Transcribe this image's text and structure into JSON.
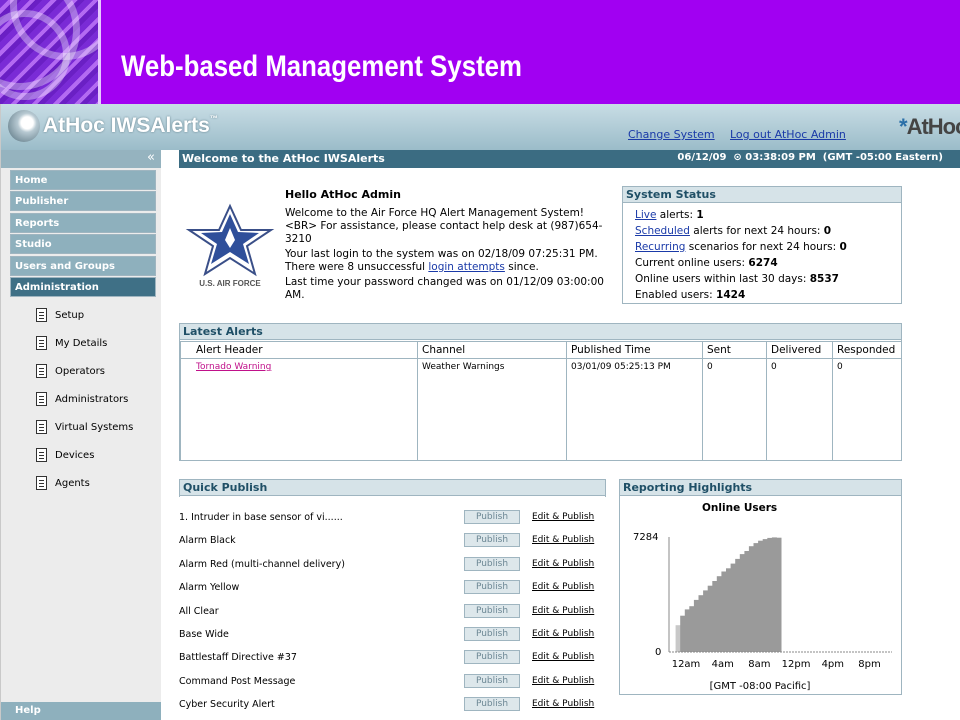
{
  "slide": {
    "title": "Web-based Management System"
  },
  "app": {
    "product_name": "AtHoc IWSAlerts",
    "trademark": "™",
    "change_system": "Change System",
    "logout": "Log out AtHoc Admin",
    "brand": "AtHoc"
  },
  "nav": {
    "collapse": "«",
    "items": [
      {
        "label": "Home"
      },
      {
        "label": "Publisher"
      },
      {
        "label": "Reports"
      },
      {
        "label": "Studio"
      },
      {
        "label": "Users and Groups"
      },
      {
        "label": "Administration"
      }
    ],
    "sub_items": [
      {
        "label": "Setup"
      },
      {
        "label": "My Details"
      },
      {
        "label": "Operators"
      },
      {
        "label": "Administrators"
      },
      {
        "label": "Virtual Systems"
      },
      {
        "label": "Devices"
      },
      {
        "label": "Agents"
      }
    ],
    "help": "Help"
  },
  "welcome": {
    "title": "Welcome to the AtHoc IWSAlerts",
    "date": "06/12/09",
    "time": "03:38:09 PM",
    "timezone": "(GMT -05:00 Eastern)"
  },
  "intro": {
    "logo_text": "U.S. AIR FORCE",
    "hello": "Hello AtHoc Admin",
    "line1": "Welcome to the Air Force HQ Alert Management System! <BR> For assistance, please contact help desk at (987)654-3210",
    "line2_pre": "Your last login to the system was on 02/18/09 07:25:31 PM. There were 8 unsuccessful",
    "line2_link": "login attempts",
    "line2_post": "since.",
    "line3": "Last time your password changed was on 01/12/09 03:00:00 AM."
  },
  "system_status": {
    "title": "System Status",
    "live_link": "Live",
    "live_text": "alerts:",
    "live_value": "1",
    "scheduled_link": "Scheduled",
    "scheduled_text": "alerts for next 24 hours:",
    "scheduled_value": "0",
    "recurring_link": "Recurring",
    "recurring_text": "scenarios for next 24 hours:",
    "recurring_value": "0",
    "online_text": "Current online users:",
    "online_value": "6274",
    "online30_text": "Online users within last 30 days:",
    "online30_value": "8537",
    "enabled_text": "Enabled users:",
    "enabled_value": "1424"
  },
  "latest_alerts": {
    "title": "Latest Alerts",
    "columns": [
      "Alert Header",
      "Channel",
      "Published Time",
      "Sent",
      "Delivered",
      "Responded"
    ],
    "rows": [
      {
        "header": "Tornado Warning",
        "channel": "Weather Warnings",
        "published": "03/01/09 05:25:13 PM",
        "sent": "0",
        "delivered": "0",
        "responded": "0"
      }
    ]
  },
  "quick_publish": {
    "title": "Quick Publish",
    "publish_label": "Publish",
    "edit_label": "Edit & Publish",
    "items": [
      "1. Intruder in base sensor of vi......",
      "Alarm Black",
      "Alarm Red (multi-channel delivery)",
      "Alarm Yellow",
      "All Clear",
      "Base Wide",
      "Battlestaff Directive #37",
      "Command Post Message",
      "Cyber Security Alert"
    ]
  },
  "reporting": {
    "title": "Reporting Highlights"
  },
  "chart_data": {
    "type": "bar",
    "title": "Online Users",
    "x_ticks": [
      "12am",
      "4am",
      "8am",
      "12pm",
      "4pm",
      "8pm"
    ],
    "y_ticks": [
      "0",
      "7284"
    ],
    "xlabel": "[GMT -08:00 Pacific]",
    "ylim": [
      0,
      7284
    ],
    "hours": [
      0.5,
      1,
      1.5,
      2,
      2.5,
      3,
      3.5,
      4,
      4.5,
      5,
      5.5,
      6,
      6.5,
      7,
      7.5,
      8,
      8.5,
      9,
      9.5,
      10,
      10.5,
      11,
      11.5
    ],
    "values": [
      1700,
      2300,
      2700,
      2900,
      3300,
      3600,
      3900,
      4200,
      4500,
      4800,
      5100,
      5300,
      5600,
      5900,
      6200,
      6400,
      6700,
      6900,
      7050,
      7150,
      7230,
      7260,
      7240
    ],
    "grid": false
  }
}
